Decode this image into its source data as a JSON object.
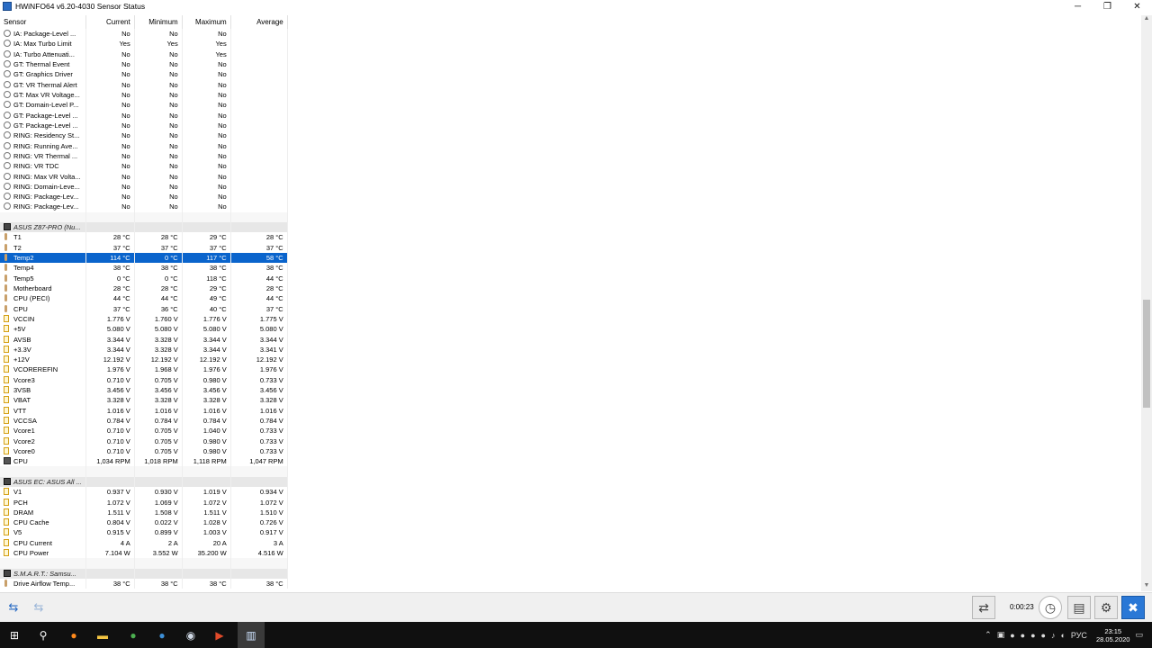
{
  "window": {
    "title": "HWiNFO64 v6.20-4030 Sensor Status",
    "buttons": {
      "minimize": "─",
      "maximize": "❐",
      "close": "✕"
    }
  },
  "columns": [
    "Sensor",
    "Current",
    "Minimum",
    "Maximum",
    "Average"
  ],
  "rows": [
    {
      "t": "r",
      "i": "clock",
      "n": "IA: Package-Level ...",
      "c": "No",
      "mi": "No",
      "ma": "No",
      "a": ""
    },
    {
      "t": "r",
      "i": "clock",
      "n": "IA: Max Turbo Limit",
      "c": "Yes",
      "mi": "Yes",
      "ma": "Yes",
      "a": ""
    },
    {
      "t": "r",
      "i": "clock",
      "n": "IA: Turbo Attenuati...",
      "c": "No",
      "mi": "No",
      "ma": "Yes",
      "a": ""
    },
    {
      "t": "r",
      "i": "clock",
      "n": "GT: Thermal Event",
      "c": "No",
      "mi": "No",
      "ma": "No",
      "a": ""
    },
    {
      "t": "r",
      "i": "clock",
      "n": "GT: Graphics Driver",
      "c": "No",
      "mi": "No",
      "ma": "No",
      "a": ""
    },
    {
      "t": "r",
      "i": "clock",
      "n": "GT: VR Thermal Alert",
      "c": "No",
      "mi": "No",
      "ma": "No",
      "a": ""
    },
    {
      "t": "r",
      "i": "clock",
      "n": "GT: Max VR Voltage...",
      "c": "No",
      "mi": "No",
      "ma": "No",
      "a": ""
    },
    {
      "t": "r",
      "i": "clock",
      "n": "GT: Domain-Level P...",
      "c": "No",
      "mi": "No",
      "ma": "No",
      "a": ""
    },
    {
      "t": "r",
      "i": "clock",
      "n": "GT: Package-Level ...",
      "c": "No",
      "mi": "No",
      "ma": "No",
      "a": ""
    },
    {
      "t": "r",
      "i": "clock",
      "n": "GT: Package-Level ...",
      "c": "No",
      "mi": "No",
      "ma": "No",
      "a": ""
    },
    {
      "t": "r",
      "i": "clock",
      "n": "RING: Residency St...",
      "c": "No",
      "mi": "No",
      "ma": "No",
      "a": ""
    },
    {
      "t": "r",
      "i": "clock",
      "n": "RING: Running Ave...",
      "c": "No",
      "mi": "No",
      "ma": "No",
      "a": ""
    },
    {
      "t": "r",
      "i": "clock",
      "n": "RING: VR Thermal ...",
      "c": "No",
      "mi": "No",
      "ma": "No",
      "a": ""
    },
    {
      "t": "r",
      "i": "clock",
      "n": "RING: VR TDC",
      "c": "No",
      "mi": "No",
      "ma": "No",
      "a": ""
    },
    {
      "t": "r",
      "i": "clock",
      "n": "RING: Max VR Volta...",
      "c": "No",
      "mi": "No",
      "ma": "No",
      "a": ""
    },
    {
      "t": "r",
      "i": "clock",
      "n": "RING: Domain-Leve...",
      "c": "No",
      "mi": "No",
      "ma": "No",
      "a": ""
    },
    {
      "t": "r",
      "i": "clock",
      "n": "RING: Package-Lev...",
      "c": "No",
      "mi": "No",
      "ma": "No",
      "a": ""
    },
    {
      "t": "r",
      "i": "clock",
      "n": "RING: Package-Lev...",
      "c": "No",
      "mi": "No",
      "ma": "No",
      "a": ""
    },
    {
      "t": "gap"
    },
    {
      "t": "g",
      "i": "chip",
      "n": "ASUS Z87-PRO (Nu..."
    },
    {
      "t": "r",
      "i": "therm",
      "n": "T1",
      "c": "28 °C",
      "mi": "28 °C",
      "ma": "29 °C",
      "a": "28 °C"
    },
    {
      "t": "r",
      "i": "therm",
      "n": "T2",
      "c": "37 °C",
      "mi": "37 °C",
      "ma": "37 °C",
      "a": "37 °C"
    },
    {
      "t": "r",
      "i": "therm",
      "n": "Temp2",
      "c": "114 °C",
      "mi": "0 °C",
      "ma": "117 °C",
      "a": "58 °C",
      "sel": true
    },
    {
      "t": "r",
      "i": "therm",
      "n": "Temp4",
      "c": "38 °C",
      "mi": "38 °C",
      "ma": "38 °C",
      "a": "38 °C"
    },
    {
      "t": "r",
      "i": "therm",
      "n": "Temp5",
      "c": "0 °C",
      "mi": "0 °C",
      "ma": "118 °C",
      "a": "44 °C"
    },
    {
      "t": "r",
      "i": "therm",
      "n": "Motherboard",
      "c": "28 °C",
      "mi": "28 °C",
      "ma": "29 °C",
      "a": "28 °C"
    },
    {
      "t": "r",
      "i": "therm",
      "n": "CPU (PECI)",
      "c": "44 °C",
      "mi": "44 °C",
      "ma": "49 °C",
      "a": "44 °C"
    },
    {
      "t": "r",
      "i": "therm",
      "n": "CPU",
      "c": "37 °C",
      "mi": "36 °C",
      "ma": "40 °C",
      "a": "37 °C"
    },
    {
      "t": "r",
      "i": "volt",
      "n": "VCCIN",
      "c": "1.776 V",
      "mi": "1.760 V",
      "ma": "1.776 V",
      "a": "1.775 V"
    },
    {
      "t": "r",
      "i": "volt",
      "n": "+5V",
      "c": "5.080 V",
      "mi": "5.080 V",
      "ma": "5.080 V",
      "a": "5.080 V"
    },
    {
      "t": "r",
      "i": "volt",
      "n": "AVSB",
      "c": "3.344 V",
      "mi": "3.328 V",
      "ma": "3.344 V",
      "a": "3.344 V"
    },
    {
      "t": "r",
      "i": "volt",
      "n": "+3.3V",
      "c": "3.344 V",
      "mi": "3.328 V",
      "ma": "3.344 V",
      "a": "3.341 V"
    },
    {
      "t": "r",
      "i": "volt",
      "n": "+12V",
      "c": "12.192 V",
      "mi": "12.192 V",
      "ma": "12.192 V",
      "a": "12.192 V"
    },
    {
      "t": "r",
      "i": "volt",
      "n": "VCOREREFIN",
      "c": "1.976 V",
      "mi": "1.968 V",
      "ma": "1.976 V",
      "a": "1.976 V"
    },
    {
      "t": "r",
      "i": "volt",
      "n": "Vcore3",
      "c": "0.710 V",
      "mi": "0.705 V",
      "ma": "0.980 V",
      "a": "0.733 V"
    },
    {
      "t": "r",
      "i": "volt",
      "n": "3VSB",
      "c": "3.456 V",
      "mi": "3.456 V",
      "ma": "3.456 V",
      "a": "3.456 V"
    },
    {
      "t": "r",
      "i": "volt",
      "n": "VBAT",
      "c": "3.328 V",
      "mi": "3.328 V",
      "ma": "3.328 V",
      "a": "3.328 V"
    },
    {
      "t": "r",
      "i": "volt",
      "n": "VTT",
      "c": "1.016 V",
      "mi": "1.016 V",
      "ma": "1.016 V",
      "a": "1.016 V"
    },
    {
      "t": "r",
      "i": "volt",
      "n": "VCCSA",
      "c": "0.784 V",
      "mi": "0.784 V",
      "ma": "0.784 V",
      "a": "0.784 V"
    },
    {
      "t": "r",
      "i": "volt",
      "n": "Vcore1",
      "c": "0.710 V",
      "mi": "0.705 V",
      "ma": "1.040 V",
      "a": "0.733 V"
    },
    {
      "t": "r",
      "i": "volt",
      "n": "Vcore2",
      "c": "0.710 V",
      "mi": "0.705 V",
      "ma": "0.980 V",
      "a": "0.733 V"
    },
    {
      "t": "r",
      "i": "volt",
      "n": "Vcore0",
      "c": "0.710 V",
      "mi": "0.705 V",
      "ma": "0.980 V",
      "a": "0.733 V"
    },
    {
      "t": "r",
      "i": "fan",
      "n": "CPU",
      "c": "1,034 RPM",
      "mi": "1,018 RPM",
      "ma": "1,118 RPM",
      "a": "1,047 RPM"
    },
    {
      "t": "gap"
    },
    {
      "t": "g",
      "i": "chip",
      "n": "ASUS EC: ASUS All ..."
    },
    {
      "t": "r",
      "i": "volt",
      "n": "V1",
      "c": "0.937 V",
      "mi": "0.930 V",
      "ma": "1.019 V",
      "a": "0.934 V"
    },
    {
      "t": "r",
      "i": "volt",
      "n": "PCH",
      "c": "1.072 V",
      "mi": "1.069 V",
      "ma": "1.072 V",
      "a": "1.072 V"
    },
    {
      "t": "r",
      "i": "volt",
      "n": "DRAM",
      "c": "1.511 V",
      "mi": "1.508 V",
      "ma": "1.511 V",
      "a": "1.510 V"
    },
    {
      "t": "r",
      "i": "volt",
      "n": "CPU Cache",
      "c": "0.804 V",
      "mi": "0.022 V",
      "ma": "1.028 V",
      "a": "0.726 V"
    },
    {
      "t": "r",
      "i": "volt",
      "n": "V5",
      "c": "0.915 V",
      "mi": "0.899 V",
      "ma": "1.003 V",
      "a": "0.917 V"
    },
    {
      "t": "r",
      "i": "volt",
      "n": "CPU Current",
      "c": "4 A",
      "mi": "2 A",
      "ma": "20 A",
      "a": "3 A"
    },
    {
      "t": "r",
      "i": "volt",
      "n": "CPU Power",
      "c": "7.104 W",
      "mi": "3.552 W",
      "ma": "35.200 W",
      "a": "4.516 W"
    },
    {
      "t": "gap"
    },
    {
      "t": "g",
      "i": "chip",
      "n": "S.M.A.R.T.: Samsu..."
    },
    {
      "t": "r",
      "i": "therm",
      "n": "Drive Airflow Temp...",
      "c": "38 °C",
      "mi": "38 °C",
      "ma": "38 °C",
      "a": "38 °C"
    }
  ],
  "bottombar": {
    "nav_left": "⇆",
    "nav_right": "⇆",
    "timer": "0:00:23"
  },
  "taskbar": {
    "tray_lang": "РУС",
    "time": "23:15",
    "date": "28.05.2020"
  },
  "colors": {
    "selection": "#0a64cc",
    "group_row": "#e7e7e7",
    "taskbar": "#101010"
  }
}
